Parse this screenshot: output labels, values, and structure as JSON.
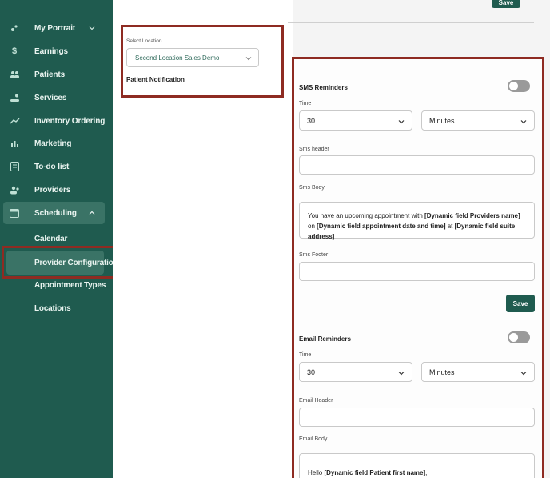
{
  "sidebar": {
    "items": [
      {
        "label": "My Portrait",
        "icon": "portrait-icon"
      },
      {
        "label": "Earnings",
        "icon": "dollar-icon"
      },
      {
        "label": "Patients",
        "icon": "users-icon"
      },
      {
        "label": "Services",
        "icon": "services-icon"
      },
      {
        "label": "Inventory Ordering",
        "icon": "trend-icon"
      },
      {
        "label": "Marketing",
        "icon": "bar-chart-icon"
      },
      {
        "label": "To-do list",
        "icon": "checklist-icon"
      },
      {
        "label": "Providers",
        "icon": "providers-icon"
      },
      {
        "label": "Scheduling",
        "icon": "calendar-icon"
      }
    ],
    "subitems": [
      {
        "label": "Calendar"
      },
      {
        "label": "Provider Configuration"
      },
      {
        "label": "Appointment Types"
      },
      {
        "label": "Locations"
      }
    ]
  },
  "header": {
    "save_label": "Save"
  },
  "location": {
    "label": "Select Location",
    "value": "Second Location Sales Demo",
    "section": "Patient Notification"
  },
  "sms": {
    "title": "SMS Reminders",
    "time_label": "Time",
    "time_value": "30",
    "unit_value": "Minutes",
    "header_label": "Sms header",
    "body_label": "Sms Body",
    "body_parts": {
      "p1": "You have an upcoming appointment with ",
      "f1": "[Dynamic field Providers name]",
      "p2": " on ",
      "f2": "[Dynamic field appointment date and time]",
      "p3": " at ",
      "f3": "[Dynamic field suite address]"
    },
    "footer_label": "Sms Footer",
    "save_label": "Save"
  },
  "email": {
    "title": "Email Reminders",
    "time_label": "Time",
    "time_value": "30",
    "unit_value": "Minutes",
    "header_label": "Email Header",
    "body_label": "Email Body",
    "body_parts": {
      "p1": "Hello ",
      "f1": "[Dynamic field Patient first name]",
      "p2": ","
    }
  },
  "colors": {
    "sidebar": "#1f5b4f",
    "accent": "#1f5b4f",
    "highlight": "#8e2b22"
  }
}
